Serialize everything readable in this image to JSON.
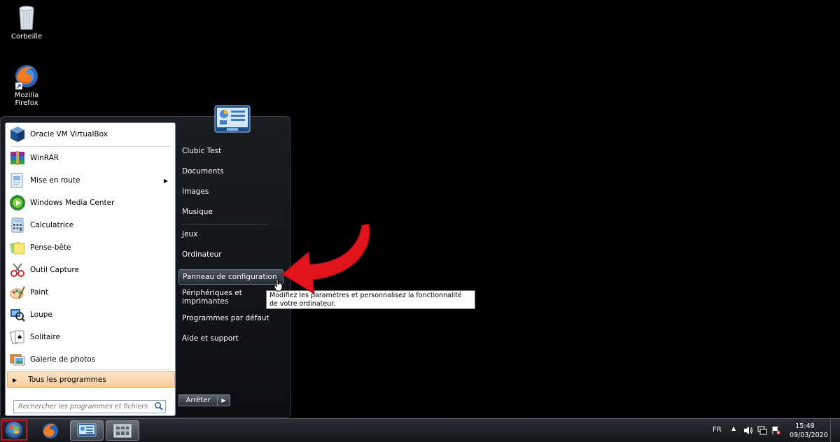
{
  "desktop": {
    "recycle_bin": "Corbeille",
    "firefox": "Mozilla Firefox"
  },
  "start_menu": {
    "programs": [
      {
        "label": "Oracle VM VirtualBox",
        "icon": "virtualbox-icon"
      },
      {
        "label": "WinRAR",
        "icon": "winrar-icon"
      },
      {
        "label": "Mise en route",
        "icon": "getting-started-icon",
        "submenu": true
      },
      {
        "label": "Windows Media Center",
        "icon": "media-center-icon"
      },
      {
        "label": "Calculatrice",
        "icon": "calculator-icon"
      },
      {
        "label": "Pense-bête",
        "icon": "sticky-notes-icon"
      },
      {
        "label": "Outil Capture",
        "icon": "snipping-tool-icon"
      },
      {
        "label": "Paint",
        "icon": "paint-icon"
      },
      {
        "label": "Loupe",
        "icon": "magnifier-icon"
      },
      {
        "label": "Solitaire",
        "icon": "solitaire-icon"
      },
      {
        "label": "Galerie de photos",
        "icon": "photo-gallery-icon"
      }
    ],
    "all_programs": "Tous les programmes",
    "search_placeholder": "Rechercher les programmes et fichiers",
    "right_items": [
      "Clubic Test",
      "Documents",
      "Images",
      "Musique",
      "Jeux",
      "Ordinateur",
      "Panneau de configuration",
      "Périphériques et imprimantes",
      "Programmes par défaut",
      "Aide et support"
    ],
    "highlighted_item": "Panneau de configuration",
    "shutdown": "Arrêter"
  },
  "tooltip": "Modifiez les paramètres et personnalisez la fonctionnalité de votre ordinateur.",
  "taskbar": {
    "language": "FR",
    "time": "15:49",
    "date": "09/03/2020"
  },
  "colors": {
    "accent_red": "#d1121e",
    "highlight_orange": "#f8cc98"
  }
}
